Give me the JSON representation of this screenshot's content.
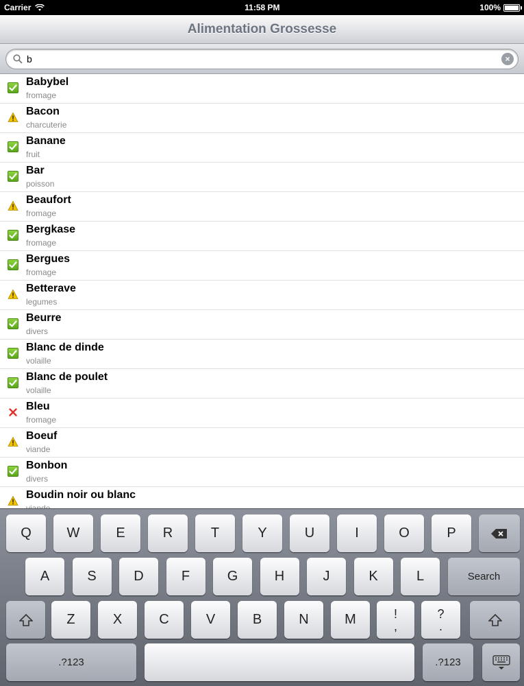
{
  "status": {
    "carrier": "Carrier",
    "time": "11:58 PM",
    "battery": "100%"
  },
  "nav": {
    "title": "Alimentation Grossesse"
  },
  "search": {
    "value": "b"
  },
  "items": [
    {
      "title": "Babybel",
      "category": "fromage",
      "status": "ok"
    },
    {
      "title": "Bacon",
      "category": "charcuterie",
      "status": "warning"
    },
    {
      "title": "Banane",
      "category": "fruit",
      "status": "ok"
    },
    {
      "title": "Bar",
      "category": "poisson",
      "status": "ok"
    },
    {
      "title": "Beaufort",
      "category": "fromage",
      "status": "warning"
    },
    {
      "title": "Bergkase",
      "category": "fromage",
      "status": "ok"
    },
    {
      "title": "Bergues",
      "category": "fromage",
      "status": "ok"
    },
    {
      "title": "Betterave",
      "category": "legumes",
      "status": "warning"
    },
    {
      "title": "Beurre",
      "category": "divers",
      "status": "ok"
    },
    {
      "title": "Blanc de dinde",
      "category": "volaille",
      "status": "ok"
    },
    {
      "title": "Blanc de poulet",
      "category": "volaille",
      "status": "ok"
    },
    {
      "title": "Bleu",
      "category": "fromage",
      "status": "no"
    },
    {
      "title": "Boeuf",
      "category": "viande",
      "status": "warning"
    },
    {
      "title": "Bonbon",
      "category": "divers",
      "status": "ok"
    },
    {
      "title": "Boudin noir ou blanc",
      "category": "viande",
      "status": "warning"
    }
  ],
  "keyboard": {
    "row1": [
      "Q",
      "W",
      "E",
      "R",
      "T",
      "Y",
      "U",
      "I",
      "O",
      "P"
    ],
    "row2": [
      "A",
      "S",
      "D",
      "F",
      "G",
      "H",
      "J",
      "K",
      "L"
    ],
    "row3": [
      "Z",
      "X",
      "C",
      "V",
      "B",
      "N",
      "M"
    ],
    "search_label": "Search",
    "numbers_label": ".?123",
    "punct1": [
      "!",
      ","
    ],
    "punct2": [
      "?",
      "."
    ]
  },
  "colors": {
    "ok": "#6cbf2a",
    "warning": "#f2c200",
    "no": "#e0302a"
  }
}
